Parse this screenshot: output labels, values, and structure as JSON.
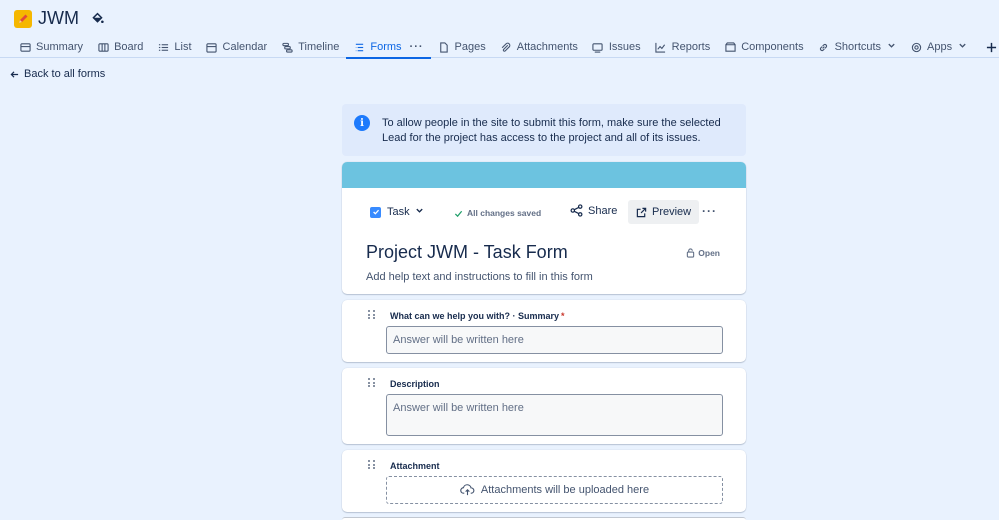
{
  "project": {
    "name": "JWM"
  },
  "tabs": [
    {
      "label": "Summary"
    },
    {
      "label": "Board"
    },
    {
      "label": "List"
    },
    {
      "label": "Calendar"
    },
    {
      "label": "Timeline"
    },
    {
      "label": "Forms"
    },
    {
      "label": "Pages"
    },
    {
      "label": "Attachments"
    },
    {
      "label": "Issues"
    },
    {
      "label": "Reports"
    },
    {
      "label": "Components"
    },
    {
      "label": "Shortcuts"
    },
    {
      "label": "Apps"
    }
  ],
  "nav": {
    "back_label": "Back to all forms"
  },
  "info": {
    "text": "To allow people in the site to submit this form, make sure the selected Lead for the project has access to the project and all of its issues."
  },
  "form": {
    "issue_type": "Task",
    "save_status": "All changes saved",
    "share_label": "Share",
    "preview_label": "Preview",
    "title": "Project JWM - Task Form",
    "access": "Open",
    "help_placeholder": "Add help text and instructions to fill in this form",
    "banner_color": "#6cc3e0",
    "fields": [
      {
        "label": "What can we help you with? · Summary",
        "required": "*",
        "placeholder": "Answer will be written here"
      },
      {
        "label": "Description",
        "placeholder": "Answer will be written here"
      },
      {
        "label": "Attachment",
        "placeholder": "Attachments will be uploaded here"
      }
    ]
  },
  "colors": {
    "accent": "#0c66e4",
    "background": "#e9f2fe",
    "info_icon": "#1d7afc",
    "checkbox": "#388bff"
  }
}
